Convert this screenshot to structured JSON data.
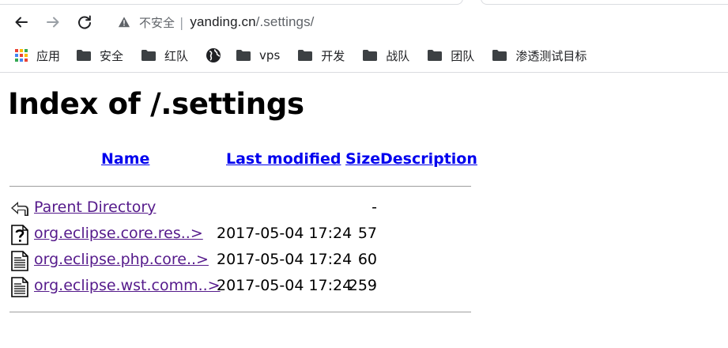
{
  "browser": {
    "security_label": "不安全",
    "separator": "|",
    "url_host": "yanding.cn",
    "url_path": "/.settings/"
  },
  "bookmarks": [
    {
      "label": "应用",
      "icon": "apps-grid-icon"
    },
    {
      "label": "安全",
      "icon": "folder-icon"
    },
    {
      "label": "红队",
      "icon": "folder-icon"
    },
    {
      "label": "",
      "icon": "globe-icon"
    },
    {
      "label": "vps",
      "icon": "folder-icon"
    },
    {
      "label": "开发",
      "icon": "folder-icon"
    },
    {
      "label": "战队",
      "icon": "folder-icon"
    },
    {
      "label": "团队",
      "icon": "folder-icon"
    },
    {
      "label": "渗透测试目标",
      "icon": "folder-icon"
    }
  ],
  "page": {
    "title": "Index of /.settings",
    "columns": {
      "name": "Name",
      "last_modified": "Last modified",
      "size": "Size",
      "description": "Description"
    },
    "rows": [
      {
        "name": "Parent Directory",
        "modified": "",
        "size": "-",
        "icon": "back-arrow-icon"
      },
      {
        "name": "org.eclipse.core.res..>",
        "modified": "2017-05-04 17:24",
        "size": "57",
        "icon": "unknown-file-icon"
      },
      {
        "name": "org.eclipse.php.core..>",
        "modified": "2017-05-04 17:24",
        "size": "60",
        "icon": "text-file-icon"
      },
      {
        "name": "org.eclipse.wst.comm..>",
        "modified": "2017-05-04 17:24",
        "size": "259",
        "icon": "text-file-icon"
      }
    ]
  }
}
